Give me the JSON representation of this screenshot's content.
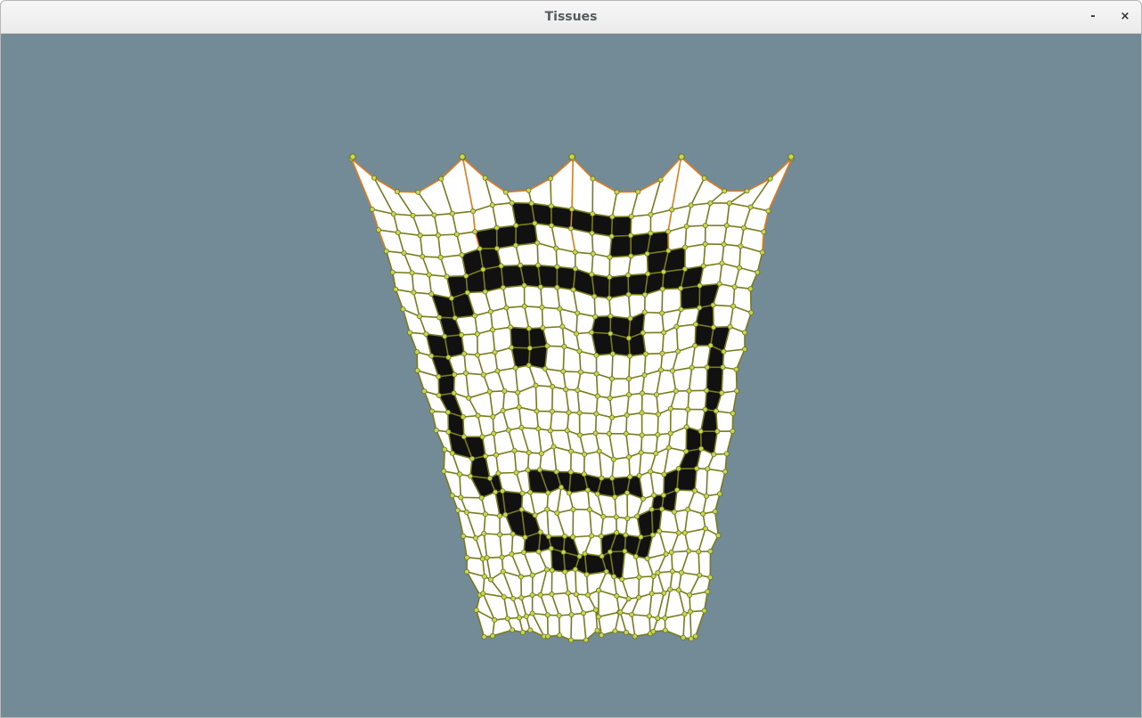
{
  "window": {
    "title": "Tissues",
    "minimize_glyph": "-",
    "close_glyph": "×"
  },
  "scene": {
    "background_color": "#738a97",
    "cloth_color": "#ffffff",
    "pattern_color": "#111111",
    "mesh_color": "#7a7a1e",
    "node_color": "#c8d84a",
    "stretch_color": "#e07b1a",
    "pinned_points": 5,
    "grid_columns": 21,
    "grid_rows": 23
  }
}
